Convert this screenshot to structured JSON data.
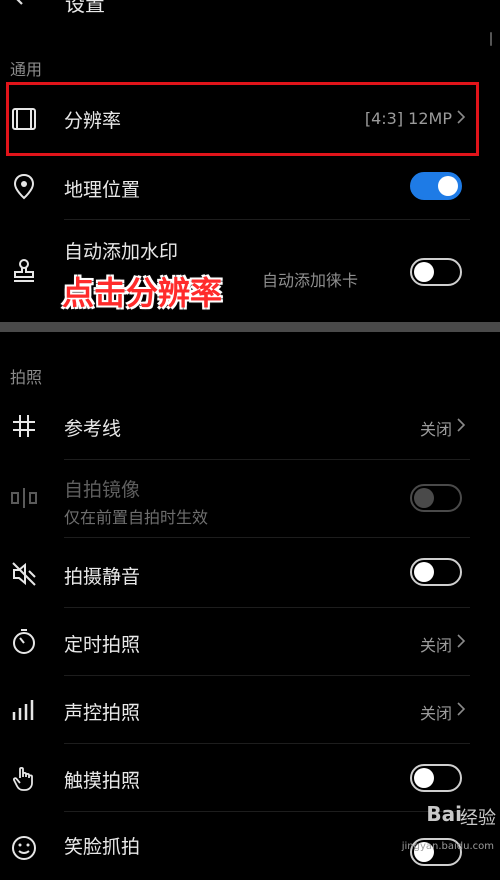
{
  "header": {
    "title": "设置"
  },
  "sections": {
    "general": "通用",
    "photo": "拍照"
  },
  "rows": {
    "resolution": {
      "label": "分辨率",
      "value": "[4:3] 12MP",
      "icon": "aspect-ratio-icon"
    },
    "location": {
      "label": "地理位置",
      "toggle": "on",
      "icon": "location-pin-icon"
    },
    "watermark": {
      "label": "自动添加水印",
      "sub_visible": "自动添加徕卡",
      "toggle": "off",
      "icon": "stamp-icon"
    },
    "gridlines": {
      "label": "参考线",
      "value": "关闭",
      "icon": "grid-hash-icon"
    },
    "mirror": {
      "label": "自拍镜像",
      "sub": "仅在前置自拍时生效",
      "toggle": "disabled",
      "icon": "mirror-icon"
    },
    "mute": {
      "label": "拍摄静音",
      "toggle": "off",
      "icon": "speaker-mute-icon"
    },
    "timer": {
      "label": "定时拍照",
      "value": "关闭",
      "icon": "timer-icon"
    },
    "voice": {
      "label": "声控拍照",
      "value": "关闭",
      "icon": "voice-bars-icon"
    },
    "touch": {
      "label": "触摸拍照",
      "toggle": "off",
      "icon": "hand-touch-icon"
    },
    "smile": {
      "label": "笑脸抓拍",
      "toggle": "off",
      "icon": "smile-icon"
    }
  },
  "annotation": {
    "text": "点击分辨率",
    "color": "#ff2b2b",
    "box_color": "#e1141a"
  },
  "watermark_brand": {
    "logo": "Bai",
    "text": "经验",
    "url": "jingyan.baidu.com"
  },
  "colors": {
    "background": "#000000",
    "accent": "#1e7be6"
  }
}
